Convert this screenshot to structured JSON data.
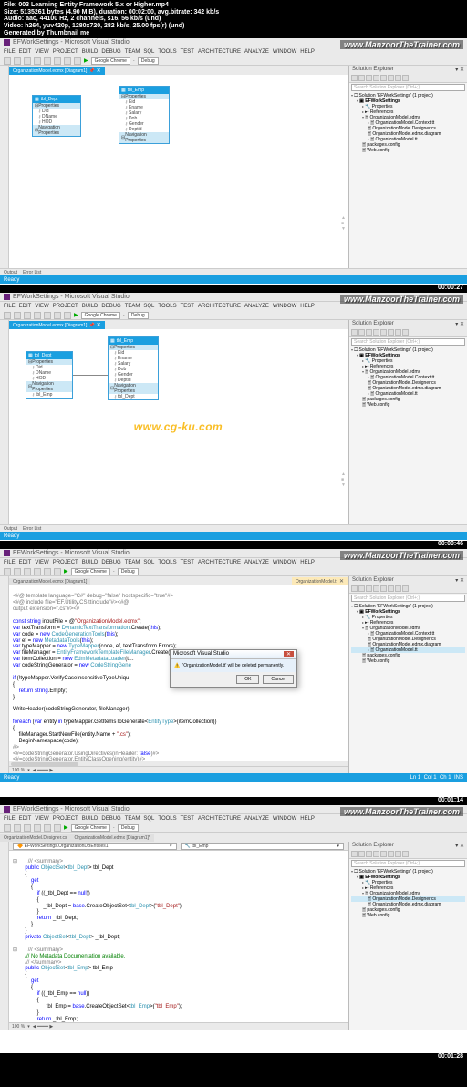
{
  "file_info": {
    "file": "File: 003 Learning Entity Framework 5.x or Higher.mp4",
    "size": "Size: 5135261 bytes (4.90 MiB), duration: 00:02:00, avg.bitrate: 342 kb/s",
    "audio": "Audio: aac, 44100 Hz, 2 channels, s16, 56 kb/s (und)",
    "video": "Video: h264, yuv420p, 1280x720, 282 kb/s, 25.00 fps(r) (und)",
    "generated": "Generated by Thumbnail me"
  },
  "watermark": "www.ManzoorTheTrainer.com",
  "center_watermark": "www.cg-ku.com",
  "vs": {
    "title": "EFWorkSettings - Microsoft Visual Studio",
    "menu": [
      "FILE",
      "EDIT",
      "VIEW",
      "PROJECT",
      "BUILD",
      "DEBUG",
      "TEAM",
      "SQL",
      "TOOLS",
      "TEST",
      "ARCHITECTURE",
      "ANALYZE",
      "WINDOW",
      "HELP"
    ],
    "toolbar": {
      "config": "Debug",
      "browser": "Google Chrome"
    },
    "status_ready": "Ready",
    "status_pos": {
      "ln": "Ln 1",
      "col": "Col 1",
      "ch": "Ch 1",
      "ins": "INS"
    }
  },
  "solution": {
    "title": "Solution Explorer",
    "search_ph": "Search Solution Explorer (Ctrl+;)",
    "root": "Solution 'EFWorkSettings' (1 project)",
    "proj": "EFWorkSettings",
    "nodes": {
      "properties": "Properties",
      "references": "References",
      "org_edmx": "OrganizationModel.edmx",
      "org_ctx": "OrganizationModel.Context.tt",
      "org_des": "OrganizationModel.Designer.cs",
      "org_diag": "OrganizationModel.edmx.diagram",
      "org_tt": "OrganizationModel.tt",
      "pkg": "packages.config",
      "web": "Web.config"
    }
  },
  "tabs": {
    "diagram": "OrganizationModel.edmx [Diagram1]",
    "code_tt": "OrganizationModel.edmx [Diagram1]",
    "org_model": "OrganizationModel.tt",
    "context": "EFWorkSettings.OrganizationDBEntities1",
    "tbl_dept_dd": "tbl_Dept",
    "tbl_emp_dd": "tbl_Emp",
    "pin": "📌",
    "close": "✕"
  },
  "entities": {
    "dept": {
      "name": "tbl_Dept",
      "props_hdr": "Properties",
      "props": [
        "Did",
        "DName",
        "HOD"
      ],
      "nav_hdr": "Navigation Properties",
      "nav": [
        "tbl_Emp"
      ]
    },
    "emp": {
      "name": "tbl_Emp",
      "props_hdr": "Properties",
      "props": [
        "Eid",
        "Ename",
        "Salary",
        "Dob",
        "Gender",
        "Deptid"
      ],
      "nav_hdr": "Navigation Properties",
      "nav": [
        "tbl_Dept"
      ]
    }
  },
  "dialog": {
    "title": "Microsoft Visual Studio",
    "msg": "'OrganizationModel.tt' will be deleted permanently.",
    "ok": "OK",
    "cancel": "Cancel",
    "close": "✕"
  },
  "bottom": {
    "output": "Output",
    "errlist": "Error List"
  },
  "timestamps": {
    "t1": "00:00:27",
    "t2": "00:00:46",
    "t3": "00:01:14",
    "t4": "00:01:28"
  },
  "code3": {
    "l1": "<#@ template language=\"C#\" debug=\"false\" hostspecific=\"true\"#>",
    "l2": "<#@ include file=\"EF.Utility.CS.ttinclude\"#><#@",
    "l3": "output extension=\".cs\"#><#",
    "l4": "",
    "l5": "const string inputFile = @\"OrganizationModel.edmx\";",
    "l6": "var textTransform = DynamicTextTransformation.Create(this);",
    "l7": "var code = new CodeGenerationTools(this);",
    "l8": "var ef = new MetadataTools(this);",
    "l9": "var typeMapper = new TypeMapper(code, ef, textTransform.Errors);",
    "l10": "var fileManager = EntityFrameworkTemplateFileManager.Create(this);",
    "l11": "var itemCollection = new EdmMetadataLoader(t…                                     eateEdmIt",
    "l12": "var codeStringGenerator = new CodeStringGene",
    "l13": "",
    "l14": "if (!typeMapper.VerifyCaseInsensitiveTypeUniqu                                     llection), i",
    "l15": "{",
    "l16": "    return string.Empty;",
    "l17": "}",
    "l18": "",
    "l19": "WriteHeader(codeStringGenerator, fileManager);",
    "l20": "",
    "l21": "foreach (var entity in typeMapper.GetItemsToGenerate<EntityType>(itemCollection))",
    "l22": "{",
    "l23": "    fileManager.StartNewFile(entity.Name + \".cs\");",
    "l24": "    BeginNamespace(code);",
    "l25": "#>",
    "l26": "<#=codeStringGenerator.UsingDirectives(inHeader: false)#>",
    "l27": "<#=codeStringGenerator.EntityClassOpening(entity)#>"
  },
  "code4": {
    "l0": "⊟ /// <summary>",
    "l1": "   public ObjectSet<tbl_Dept> tbl_Dept",
    "l2": "   {",
    "l3": "       get",
    "l4": "       {",
    "l5": "           if ((_tbl_Dept == null))",
    "l6": "           {",
    "l7": "               _tbl_Dept = base.CreateObjectSet<tbl_Dept>(\"tbl_Dept\");",
    "l8": "           }",
    "l9": "           return _tbl_Dept;",
    "l10": "       }",
    "l11": "   }",
    "l12": "   private ObjectSet<tbl_Dept> _tbl_Dept;",
    "l13": "",
    "l14": "⊟ /// <summary>",
    "l15": "   /// No Metadata Documentation available.",
    "l16": "   /// </summary>",
    "l17": "   public ObjectSet<tbl_Emp> tbl_Emp",
    "l18": "   {",
    "l19": "       get",
    "l20": "       {",
    "l21": "           if ((_tbl_Emp == null))",
    "l22": "           {",
    "l23": "               _tbl_Emp = base.CreateObjectSet<tbl_Emp>(\"tbl_Emp\");",
    "l24": "           }",
    "l25": "           return _tbl_Emp;"
  },
  "zoom": "100 %"
}
